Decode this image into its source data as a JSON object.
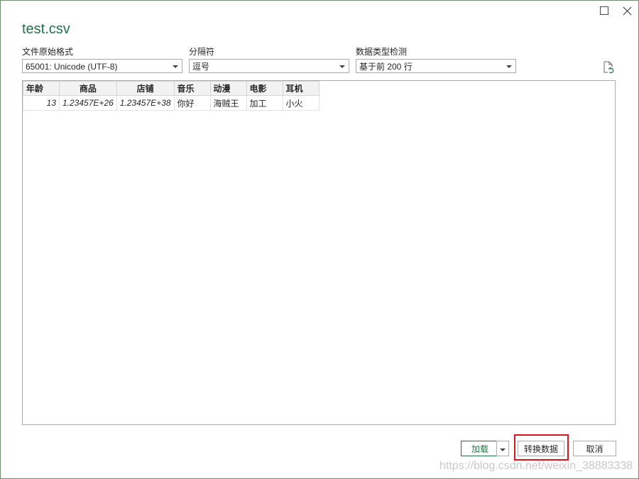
{
  "window": {
    "title": "test.csv",
    "maximize_icon": "maximize-icon",
    "close_icon": "close-icon"
  },
  "controls": {
    "file_origin": {
      "label": "文件原始格式",
      "value": "65001: Unicode (UTF-8)"
    },
    "delimiter": {
      "label": "分隔符",
      "value": "逗号"
    },
    "type_detection": {
      "label": "数据类型检测",
      "value": "基于前 200 行"
    },
    "refresh_icon": "refresh-file-icon"
  },
  "table": {
    "columns": [
      "年龄",
      "商品",
      "店铺",
      "音乐",
      "动漫",
      "电影",
      "耳机"
    ],
    "rows": [
      [
        "13",
        "1.23457E+26",
        "1.23457E+38",
        "你好",
        "海贼王",
        "加工",
        "小火"
      ]
    ]
  },
  "footer": {
    "load_label": "加载",
    "transform_label": "转换数据",
    "cancel_label": "取消",
    "highlight_color": "#d9141c"
  },
  "watermark": "https://blog.csdn.net/weixin_38883338",
  "colors": {
    "accent": "#217346"
  }
}
